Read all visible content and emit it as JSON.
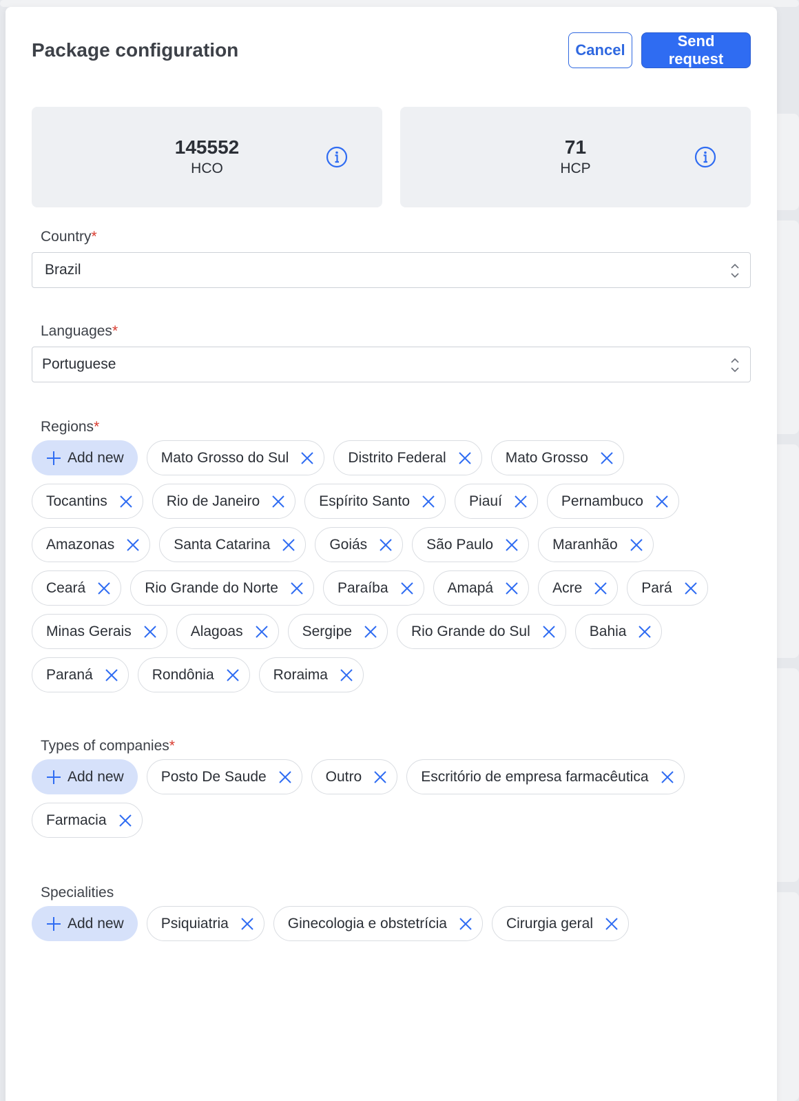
{
  "modal": {
    "title": "Package configuration",
    "cancel_label": "Cancel",
    "send_label": "Send request"
  },
  "stats": [
    {
      "value": "145552",
      "label": "HCO",
      "icon": "info-icon"
    },
    {
      "value": "71",
      "label": "HCP",
      "icon": "info-icon"
    }
  ],
  "country": {
    "label": "Country",
    "required_mark": "*",
    "value": "Brazil"
  },
  "languages": {
    "label": "Languages",
    "required_mark": "*",
    "value": "Portuguese"
  },
  "regions": {
    "label": "Regions",
    "required_mark": "*",
    "add_label": "Add new",
    "items": [
      "Mato Grosso do Sul",
      "Distrito Federal",
      "Mato Grosso",
      "Tocantins",
      "Rio de Janeiro",
      "Espírito Santo",
      "Piauí",
      "Pernambuco",
      "Amazonas",
      "Santa Catarina",
      "Goiás",
      "São Paulo",
      "Maranhão",
      "Ceará",
      "Rio Grande do Norte",
      "Paraíba",
      "Amapá",
      "Acre",
      "Pará",
      "Minas Gerais",
      "Alagoas",
      "Sergipe",
      "Rio Grande do Sul",
      "Bahia",
      "Paraná",
      "Rondônia",
      "Roraima"
    ]
  },
  "company_types": {
    "label": "Types of companies",
    "required_mark": "*",
    "add_label": "Add new",
    "items": [
      "Posto De Saude",
      "Outro",
      "Escritório de empresa farmacêutica",
      "Farmacia"
    ]
  },
  "specialities": {
    "label": "Specialities",
    "add_label": "Add new",
    "items": [
      "Psiquiatria",
      "Ginecologia e obstetrícia",
      "Cirurgia geral"
    ]
  },
  "colors": {
    "primary": "#2f6cf2",
    "add_chip_bg": "#d6e1fa",
    "required": "#d93b2f",
    "stat_bg": "#eef0f3"
  }
}
